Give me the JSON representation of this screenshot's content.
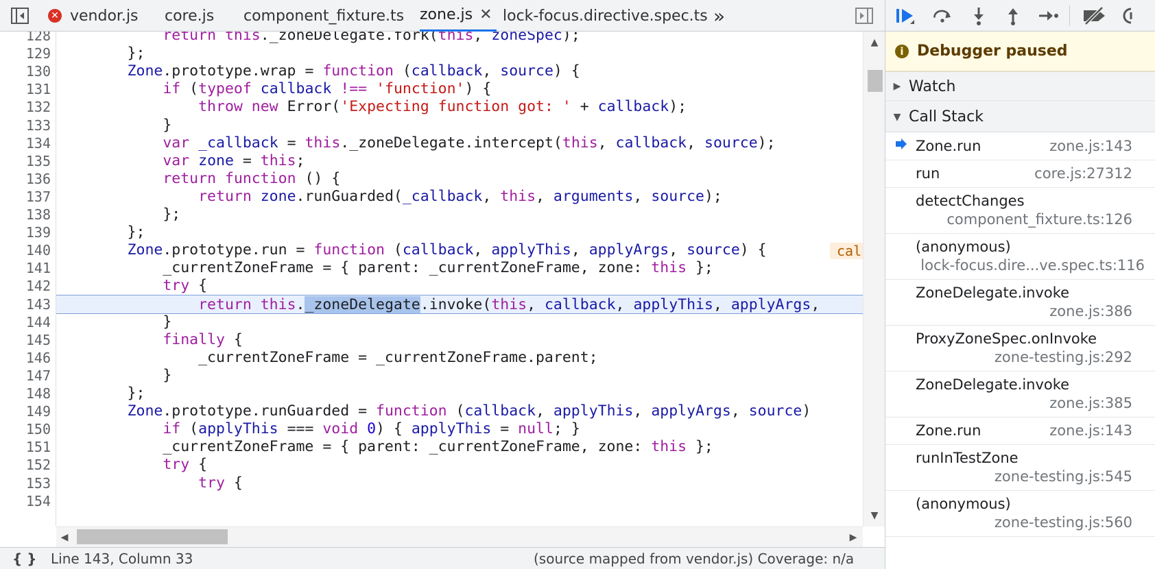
{
  "editor": {
    "tabs": [
      {
        "label": "vendor.js",
        "error": true
      },
      {
        "label": "core.js"
      },
      {
        "label": "component_fixture.ts"
      },
      {
        "label": "zone.js",
        "active": true,
        "close_glyph": "✕"
      },
      {
        "label": "lock-focus.directive.spec.ts"
      }
    ],
    "more_tabs_glyph": "»",
    "inline_value_badge": "cal",
    "lines": [
      {
        "n": "128",
        "html": "            <span class=\"kw\">return</span> <span class=\"kw\">this</span>._zoneDelegate.fork(<span class=\"kw\">this</span>, <span class=\"var\">zoneSpec</span>);"
      },
      {
        "n": "129",
        "html": "        };"
      },
      {
        "n": "130",
        "html": "        <span class=\"var\">Zone</span>.prototype.wrap = <span class=\"kw\">function</span> (<span class=\"var\">callback</span>, <span class=\"var\">source</span>) {"
      },
      {
        "n": "131",
        "html": "            <span class=\"kw\">if</span> (<span class=\"kw\">typeof</span> <span class=\"var\">callback</span> <span class=\"kw\">!==</span> <span class=\"str\">'function'</span>) {"
      },
      {
        "n": "132",
        "html": "                <span class=\"kw\">throw</span> <span class=\"kw\">new</span> Error(<span class=\"str\">'Expecting function got: '</span> + <span class=\"var\">callback</span>);"
      },
      {
        "n": "133",
        "html": "            }"
      },
      {
        "n": "134",
        "html": "            <span class=\"kw\">var</span> <span class=\"var\">_callback</span> = <span class=\"kw\">this</span>._zoneDelegate.intercept(<span class=\"kw\">this</span>, <span class=\"var\">callback</span>, <span class=\"var\">source</span>);"
      },
      {
        "n": "135",
        "html": "            <span class=\"kw\">var</span> <span class=\"var\">zone</span> = <span class=\"kw\">this</span>;"
      },
      {
        "n": "136",
        "html": "            <span class=\"kw\">return</span> <span class=\"kw\">function</span> () {"
      },
      {
        "n": "137",
        "html": "                <span class=\"kw\">return</span> <span class=\"var\">zone</span>.runGuarded(<span class=\"var\">_callback</span>, <span class=\"kw\">this</span>, <span class=\"var\">arguments</span>, <span class=\"var\">source</span>);"
      },
      {
        "n": "138",
        "html": "            };"
      },
      {
        "n": "139",
        "html": "        };"
      },
      {
        "n": "140",
        "html": "        <span class=\"var\">Zone</span>.prototype.run = <span class=\"kw\">function</span> (<span class=\"var\">callback</span>, <span class=\"var\">applyThis</span>, <span class=\"var\">applyArgs</span>, <span class=\"var\">source</span>) {"
      },
      {
        "n": "141",
        "html": "            _currentZoneFrame = { parent: _currentZoneFrame, zone: <span class=\"kw\">this</span> };"
      },
      {
        "n": "142",
        "html": "            <span class=\"kw\">try</span> {"
      },
      {
        "n": "143",
        "html": "                <span class=\"kw\">return</span> <span class=\"kw\">this</span>.<span class=\"sel\">_zoneDelegate</span>.invoke(<span class=\"kw\">this</span>, <span class=\"var\">callback</span>, <span class=\"var\">applyThis</span>, <span class=\"var\">applyArgs</span>,",
        "current": true
      },
      {
        "n": "144",
        "html": "            }"
      },
      {
        "n": "145",
        "html": "            <span class=\"kw\">finally</span> {"
      },
      {
        "n": "146",
        "html": "                _currentZoneFrame = _currentZoneFrame.parent;"
      },
      {
        "n": "147",
        "html": "            }"
      },
      {
        "n": "148",
        "html": "        };"
      },
      {
        "n": "149",
        "html": "        <span class=\"var\">Zone</span>.prototype.runGuarded = <span class=\"kw\">function</span> (<span class=\"var\">callback</span>, <span class=\"var\">applyThis</span>, <span class=\"var\">applyArgs</span>, <span class=\"var\">source</span>)"
      },
      {
        "n": "150",
        "html": "            <span class=\"kw\">if</span> (<span class=\"var\">applyThis</span> === <span class=\"kw\">void</span> <span class=\"num\">0</span>) { <span class=\"var\">applyThis</span> = <span class=\"kw\">null</span>; }"
      },
      {
        "n": "151",
        "html": "            _currentZoneFrame = { parent: _currentZoneFrame, zone: <span class=\"kw\">this</span> };"
      },
      {
        "n": "152",
        "html": "            <span class=\"kw\">try</span> {"
      },
      {
        "n": "153",
        "html": "                <span class=\"kw\">try</span> {"
      },
      {
        "n": "154",
        "html": ""
      }
    ]
  },
  "status": {
    "braces": "{ }",
    "position": "Line 143, Column 33",
    "source_map": "(source mapped from vendor.js)  Coverage: n/a"
  },
  "debugger": {
    "paused_label": "Debugger paused",
    "watch_label": "Watch",
    "call_stack_label": "Call Stack",
    "frames": [
      {
        "name": "Zone.run",
        "loc": "zone.js:143",
        "current": true,
        "inline": true
      },
      {
        "name": "run",
        "loc": "core.js:27312",
        "inline": true
      },
      {
        "name": "detectChanges",
        "loc": "component_fixture.ts:126"
      },
      {
        "name": "(anonymous)",
        "loc": "lock-focus.dire...ve.spec.ts:116"
      },
      {
        "name": "ZoneDelegate.invoke",
        "loc": "zone.js:386"
      },
      {
        "name": "ProxyZoneSpec.onInvoke",
        "loc": "zone-testing.js:292"
      },
      {
        "name": "ZoneDelegate.invoke",
        "loc": "zone.js:385"
      },
      {
        "name": "Zone.run",
        "loc": "zone.js:143",
        "inline": true
      },
      {
        "name": "runInTestZone",
        "loc": "zone-testing.js:545"
      },
      {
        "name": "(anonymous)",
        "loc": "zone-testing.js:560"
      }
    ]
  },
  "colors": {
    "accent": "#1a73e8",
    "current_line_bg": "#e8f0fe",
    "paused_banner_bg": "#fffbe5",
    "keyword": "#a01ea0",
    "string": "#c41a16"
  }
}
